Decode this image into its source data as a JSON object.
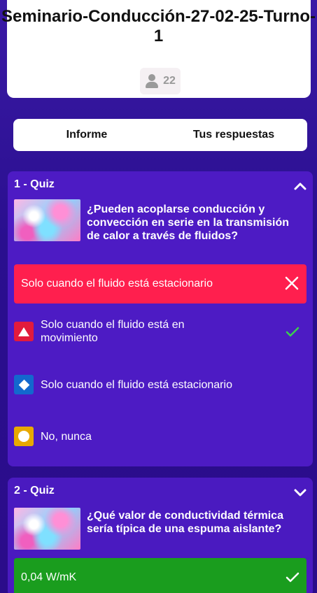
{
  "header": {
    "title": "Seminario-Conducción-27-02-25-Turno-1",
    "players_count": "22"
  },
  "tabs": [
    {
      "label": "Informe"
    },
    {
      "label": "Tus respuestas"
    }
  ],
  "quizzes": [
    {
      "label": "1 - Quiz",
      "question": "¿Pueden acoplarse conducción y convección en serie en la transmisión de calor a través de fluidos?",
      "selected_answer": "Solo cuando el fluido está estacionario",
      "options": [
        {
          "text": "Solo cuando el fluido está en movimiento",
          "shape": "triangle",
          "color": "#e21b3c",
          "correct": true
        },
        {
          "text": "Solo cuando el fluido está estacionario",
          "shape": "diamond",
          "color": "#1368ce",
          "correct": false
        },
        {
          "text": "No, nunca",
          "shape": "circle",
          "color": "#e8a900",
          "correct": false
        }
      ]
    },
    {
      "label": "2 - Quiz",
      "question": "¿Qué valor de conductividad térmica sería típica de una espuma aislante?",
      "selected_answer": "0,04 W/mK"
    }
  ],
  "colors": {
    "wrong": "#ff1f4e",
    "correct": "#1a9d1e",
    "check": "#3ccf4e"
  }
}
